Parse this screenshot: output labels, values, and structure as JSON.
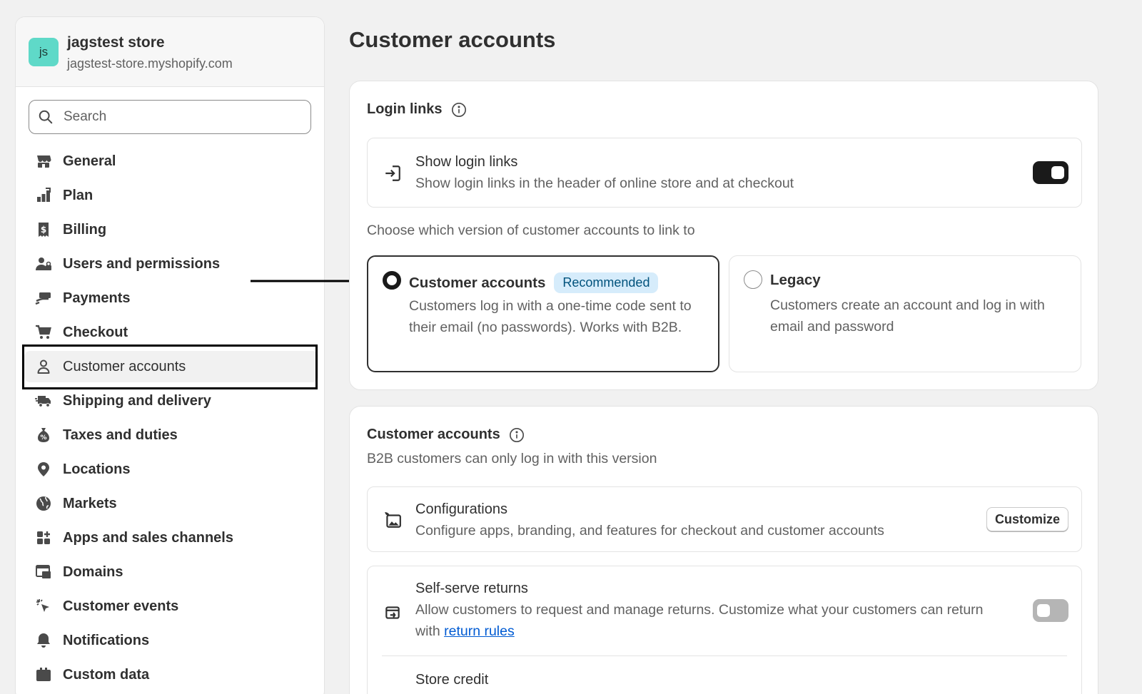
{
  "store": {
    "initials": "js",
    "name": "jagstest store",
    "domain": "jagstest-store.myshopify.com"
  },
  "search": {
    "placeholder": "Search"
  },
  "nav": [
    {
      "label": "General",
      "icon": "store-icon"
    },
    {
      "label": "Plan",
      "icon": "plan-icon"
    },
    {
      "label": "Billing",
      "icon": "receipt-icon"
    },
    {
      "label": "Users and permissions",
      "icon": "users-icon"
    },
    {
      "label": "Payments",
      "icon": "payments-icon"
    },
    {
      "label": "Checkout",
      "icon": "cart-icon"
    },
    {
      "label": "Customer accounts",
      "icon": "person-icon",
      "active": true
    },
    {
      "label": "Shipping and delivery",
      "icon": "truck-icon"
    },
    {
      "label": "Taxes and duties",
      "icon": "tax-icon"
    },
    {
      "label": "Locations",
      "icon": "location-pin-icon"
    },
    {
      "label": "Markets",
      "icon": "globe-icon"
    },
    {
      "label": "Apps and sales channels",
      "icon": "apps-icon"
    },
    {
      "label": "Domains",
      "icon": "domains-icon"
    },
    {
      "label": "Customer events",
      "icon": "cursor-click-icon"
    },
    {
      "label": "Notifications",
      "icon": "bell-icon"
    },
    {
      "label": "Custom data",
      "icon": "custom-data-icon"
    }
  ],
  "page": {
    "title": "Customer accounts"
  },
  "login_links": {
    "title": "Login links",
    "show_login": {
      "title": "Show login links",
      "description": "Show login links in the header of online store and at checkout",
      "enabled": true
    },
    "choose_text": "Choose which version of customer accounts to link to",
    "options": [
      {
        "title": "Customer accounts",
        "badge": "Recommended",
        "description": "Customers log in with a one-time code sent to their email (no passwords). Works with B2B.",
        "selected": true
      },
      {
        "title": "Legacy",
        "description": "Customers create an account and log in with email and password",
        "selected": false
      }
    ]
  },
  "customer_accounts": {
    "title": "Customer accounts",
    "subtitle": "B2B customers can only log in with this version",
    "configurations": {
      "title": "Configurations",
      "description": "Configure apps, branding, and features for checkout and customer accounts",
      "button": "Customize"
    },
    "self_serve": {
      "title": "Self-serve returns",
      "description": "Allow customers to request and manage returns. Customize what your customers can return with",
      "link": "return rules",
      "enabled": false
    },
    "store_credit": {
      "title": "Store credit"
    }
  },
  "colors": {
    "accent_teal": "#5fd9c8",
    "badge_bg": "#d6ecfb",
    "link": "#005bd3"
  }
}
